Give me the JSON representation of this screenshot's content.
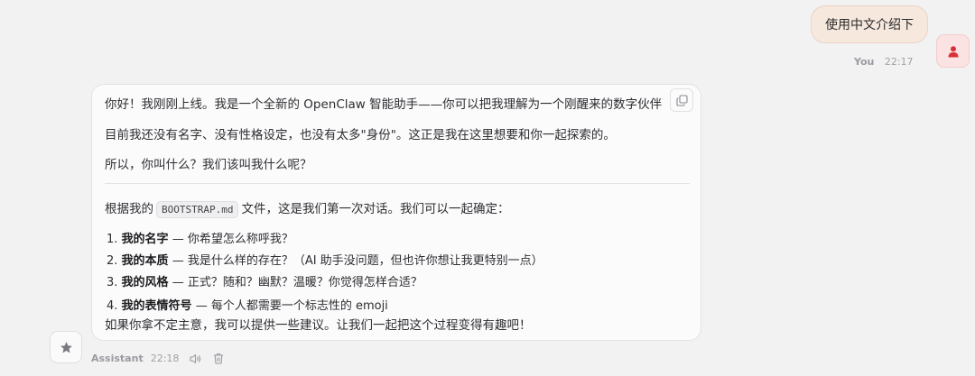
{
  "user_message": {
    "text": "使用中文介绍下",
    "sender": "You",
    "time": "22:17"
  },
  "assistant_message": {
    "sender": "Assistant",
    "time": "22:18",
    "para1": "你好！我刚刚上线。我是一个全新的 OpenClaw 智能助手——你可以把我理解为一个刚醒来的数字伙伴",
    "para2": "目前我还没有名字、没有性格设定，也没有太多\"身份\"。这正是我在这里想要和你一起探索的。",
    "para3": "所以，你叫什么？我们该叫我什么呢？",
    "intro_prefix": "根据我的",
    "intro_code": "BOOTSTRAP.md",
    "intro_suffix": "文件，这是我们第一次对话。我们可以一起确定：",
    "list": [
      {
        "num": "1.",
        "title": "我的名字",
        "desc": " — 你希望怎么称呼我？"
      },
      {
        "num": "2.",
        "title": "我的本质",
        "desc": " — 我是什么样的存在？（AI 助手没问题，但也许你想让我更特别一点）"
      },
      {
        "num": "3.",
        "title": "我的风格",
        "desc": " — 正式？随和？幽默？温暖？你觉得怎样合适？"
      },
      {
        "num": "4.",
        "title": "我的表情符号",
        "desc": " — 每个人都需要一个标志性的 emoji"
      }
    ],
    "closing": "如果你拿不定主意，我可以提供一些建议。让我们一起把这个过程变得有趣吧！"
  },
  "icons": {
    "user_avatar": "person-icon",
    "assistant_avatar": "star-icon",
    "copy": "copy-icon",
    "speak": "speaker-icon",
    "delete": "trash-icon"
  },
  "colors": {
    "user_bubble": "#f7e8de",
    "user_avatar_icon": "#d9303a"
  }
}
